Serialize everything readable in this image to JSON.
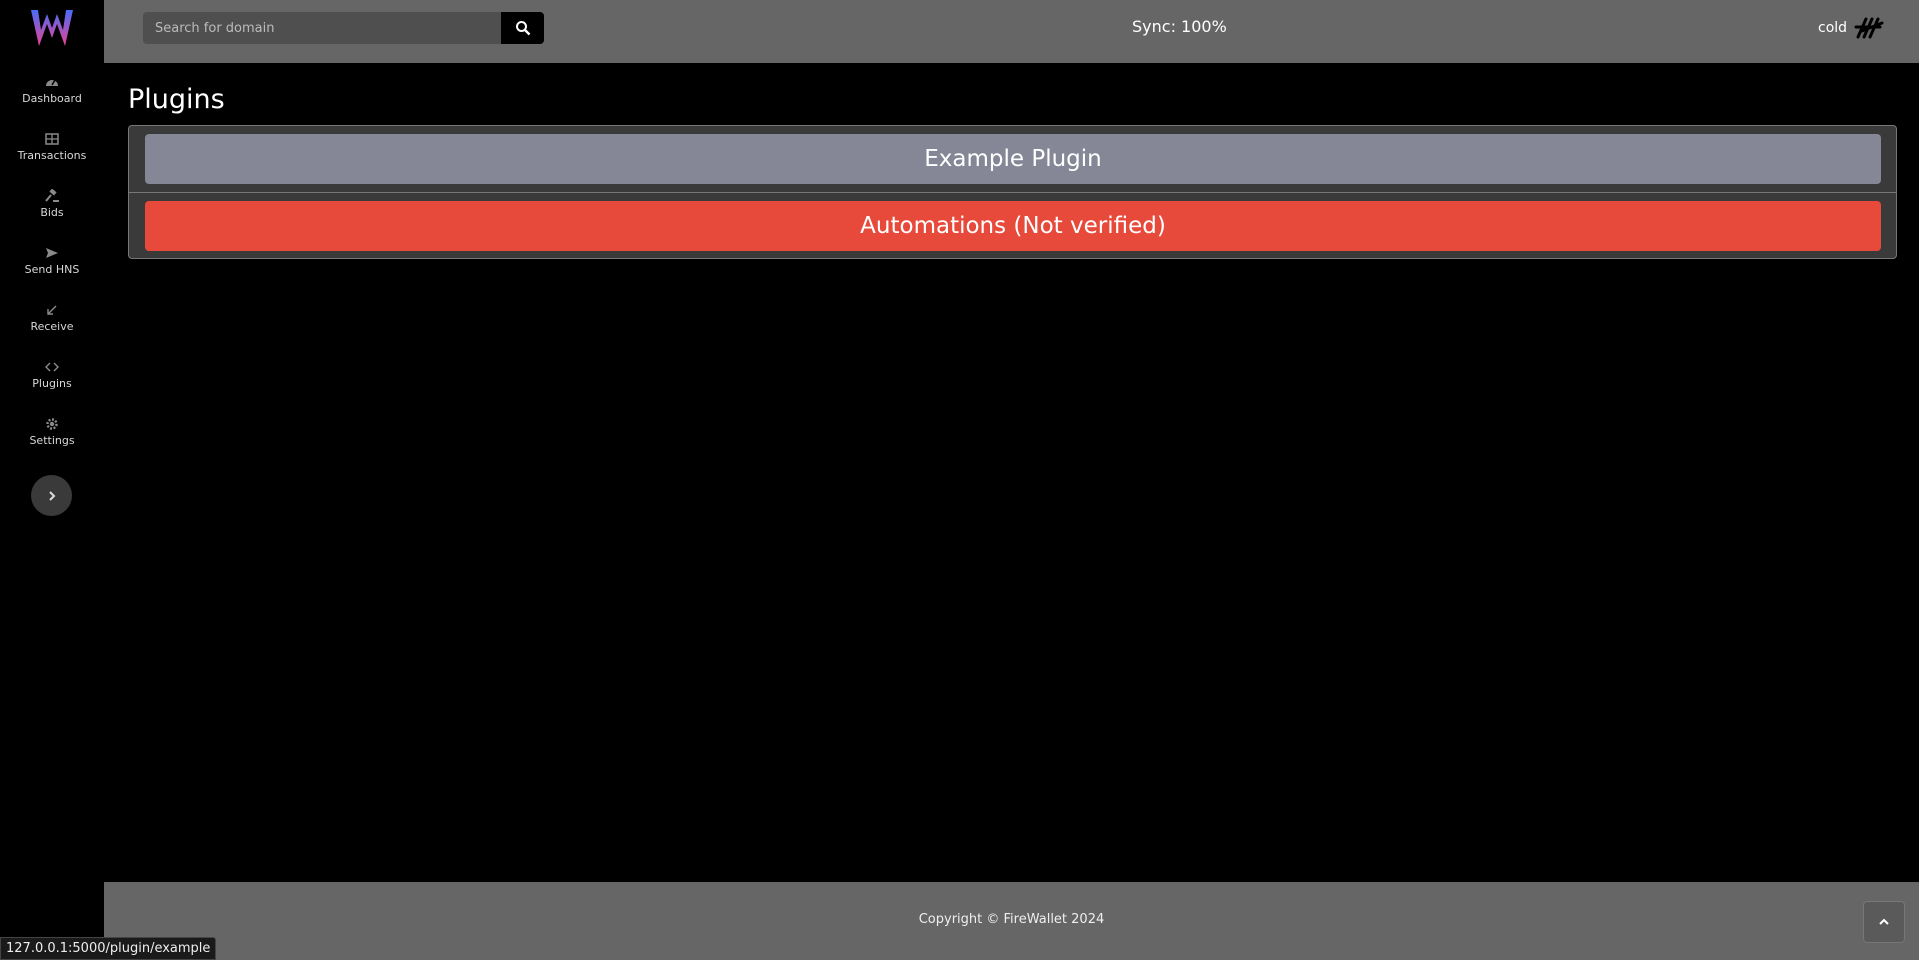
{
  "app": {
    "logo_icon": "firewallet-logo",
    "brand_colors": [
      "#4a6cf7",
      "#e84393"
    ]
  },
  "sidebar": {
    "items": [
      {
        "label": "Dashboard",
        "icon": "tachometer-icon"
      },
      {
        "label": "Transactions",
        "icon": "table-icon"
      },
      {
        "label": "Bids",
        "icon": "gavel-icon"
      },
      {
        "label": "Send HNS",
        "icon": "paper-plane-icon"
      },
      {
        "label": "Receive",
        "icon": "arrow-down-left-icon"
      },
      {
        "label": "Plugins",
        "icon": "code-icon"
      },
      {
        "label": "Settings",
        "icon": "gear-icon"
      }
    ],
    "toggle_icon": "chevron-right-icon"
  },
  "topbar": {
    "search_placeholder": "Search for domain",
    "search_icon": "search-icon",
    "sync": "Sync: 100%",
    "wallet_name": "cold",
    "avatar_icon": "handshake-logo-icon"
  },
  "main": {
    "title": "Plugins",
    "plugins": [
      {
        "label": "Example Plugin",
        "color": "#858796"
      },
      {
        "label": "Automations (Not verified)",
        "color": "#e74a3b"
      }
    ]
  },
  "footer": {
    "copyright": "Copyright © FireWallet 2024",
    "scroll_top_icon": "chevron-up-icon"
  },
  "status_bar": {
    "url": "127.0.0.1:5000/plugin/example"
  }
}
